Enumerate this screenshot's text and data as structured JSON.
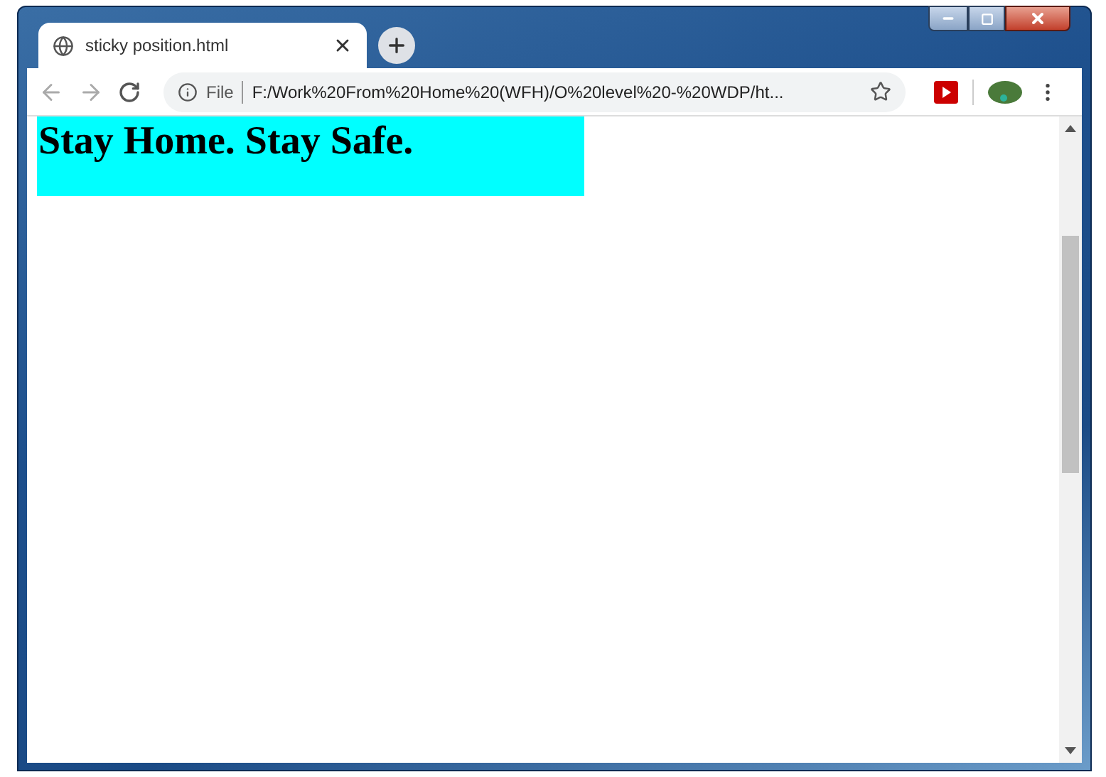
{
  "tabs": [
    {
      "title": "sticky position.html",
      "selected": true
    }
  ],
  "address_bar": {
    "scheme_label": "File",
    "url": "F:/Work%20From%20Home%20(WFH)/O%20level%20-%20WDP/ht..."
  },
  "page": {
    "heading": "Stay Home. Stay Safe."
  }
}
